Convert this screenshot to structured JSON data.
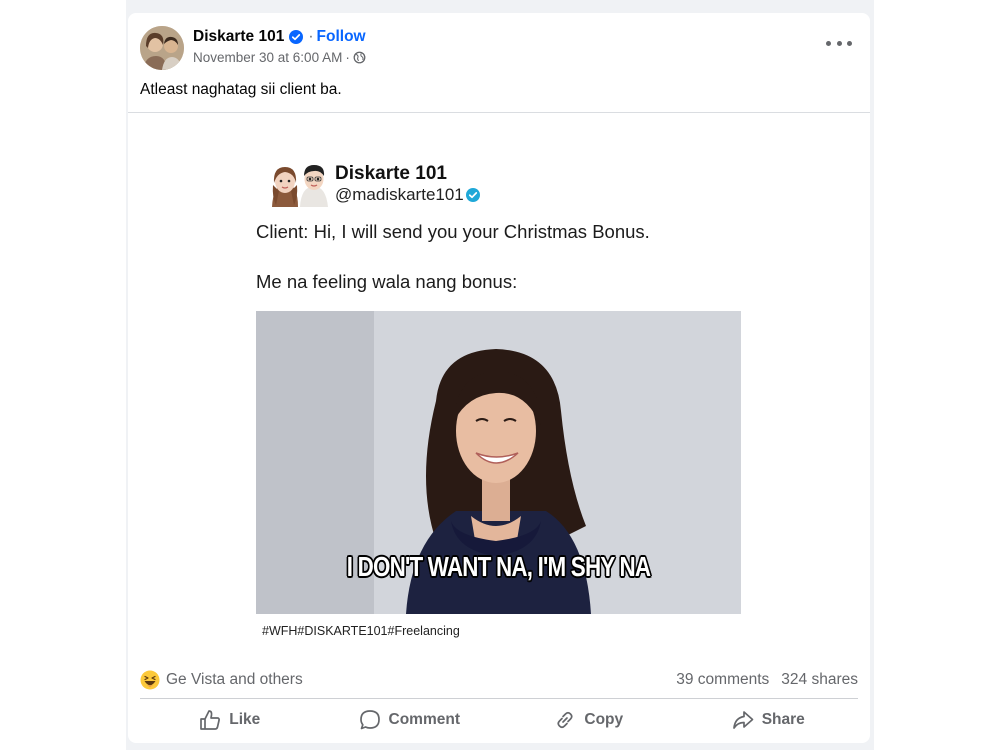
{
  "post": {
    "author": "Diskarte 101",
    "follow_label": "Follow",
    "timestamp": "November 30 at 6:00 AM",
    "audience_icon": "globe-icon",
    "caption": "Atleast naghatag sii client ba."
  },
  "meme": {
    "brand_name": "Diskarte 101",
    "handle": "@madiskarte101",
    "line1": "Client: Hi, I will send you your Christmas Bonus.",
    "line2": "Me na feeling wala nang bonus:",
    "overlay_text": "I DON'T WANT NA, I'M SHY NA",
    "hashtags": "#WFH#DISKARTE101#Freelancing"
  },
  "engagement": {
    "reaction_icon": "haha-emoji-icon",
    "reactions_text": "Ge Vista and others",
    "comments": "39 comments",
    "shares": "324 shares"
  },
  "actions": {
    "like": "Like",
    "comment": "Comment",
    "copy": "Copy",
    "share": "Share"
  },
  "colors": {
    "link_blue": "#0866ff",
    "secondary_text": "#65676b",
    "page_background": "#f0f2f5"
  }
}
